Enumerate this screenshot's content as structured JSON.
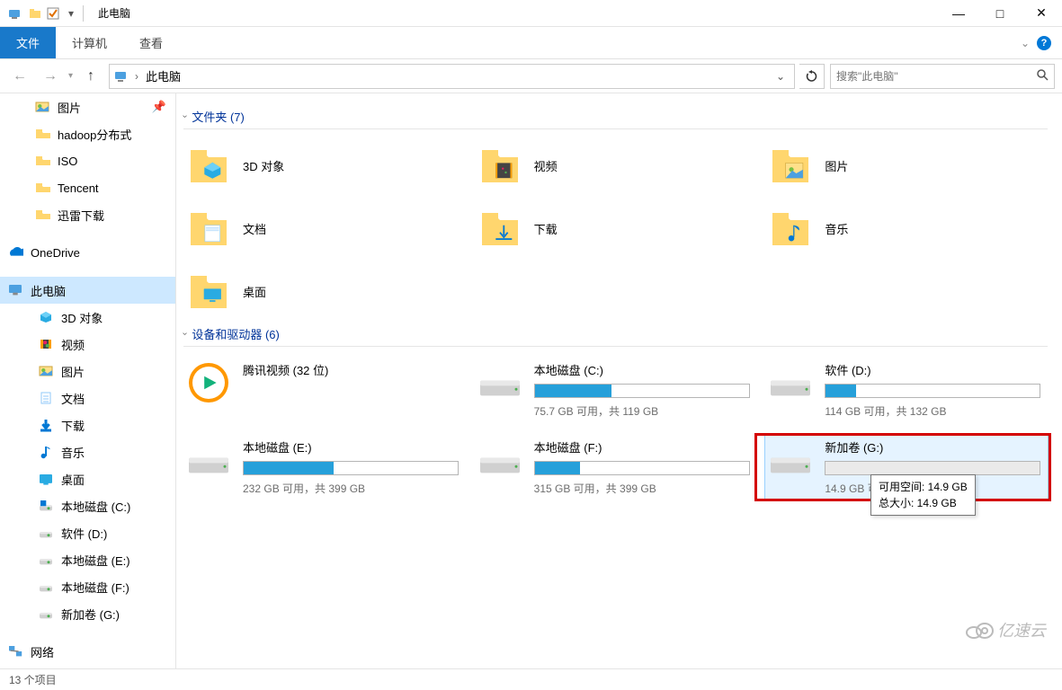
{
  "window": {
    "title": "此电脑",
    "minimize": "—",
    "maximize": "□",
    "close": "✕"
  },
  "ribbon": {
    "file": "文件",
    "computer": "计算机",
    "view": "查看",
    "chevron": "⌄",
    "help": "?"
  },
  "nav": {
    "back": "←",
    "forward": "→",
    "up": "↑",
    "location": "此电脑",
    "sep": "›",
    "refresh": "⟳",
    "search_placeholder": "搜索\"此电脑\""
  },
  "sidebar": [
    {
      "label": "图片",
      "icon": "pictures-icon",
      "indent": 1,
      "pin": true
    },
    {
      "label": "hadoop分布式",
      "icon": "folder-icon",
      "indent": 1
    },
    {
      "label": "ISO",
      "icon": "folder-icon",
      "indent": 1
    },
    {
      "label": "Tencent",
      "icon": "folder-icon",
      "indent": 1
    },
    {
      "label": "迅雷下载",
      "icon": "folder-icon",
      "indent": 1
    },
    {
      "spacer": true
    },
    {
      "label": "OneDrive",
      "icon": "onedrive-icon",
      "indent": 0
    },
    {
      "spacer": true
    },
    {
      "label": "此电脑",
      "icon": "this-pc-icon",
      "indent": 0,
      "selected": true
    },
    {
      "label": "3D 对象",
      "icon": "3d-objects-icon",
      "indent": 2
    },
    {
      "label": "视频",
      "icon": "videos-icon",
      "indent": 2
    },
    {
      "label": "图片",
      "icon": "pictures-icon",
      "indent": 2
    },
    {
      "label": "文档",
      "icon": "documents-icon",
      "indent": 2
    },
    {
      "label": "下载",
      "icon": "downloads-icon",
      "indent": 2
    },
    {
      "label": "音乐",
      "icon": "music-icon",
      "indent": 2
    },
    {
      "label": "桌面",
      "icon": "desktop-icon",
      "indent": 2
    },
    {
      "label": "本地磁盘 (C:)",
      "icon": "drive-c-icon",
      "indent": 2
    },
    {
      "label": "软件 (D:)",
      "icon": "drive-icon",
      "indent": 2
    },
    {
      "label": "本地磁盘 (E:)",
      "icon": "drive-icon",
      "indent": 2
    },
    {
      "label": "本地磁盘 (F:)",
      "icon": "drive-icon",
      "indent": 2
    },
    {
      "label": "新加卷 (G:)",
      "icon": "drive-icon",
      "indent": 2
    },
    {
      "spacer": true
    },
    {
      "label": "网络",
      "icon": "network-icon",
      "indent": 0
    }
  ],
  "groups": {
    "folders": {
      "header": "文件夹 (7)"
    },
    "drives": {
      "header": "设备和驱动器 (6)"
    }
  },
  "folders": [
    {
      "label": "3D 对象",
      "icon": "3d-objects-icon"
    },
    {
      "label": "视频",
      "icon": "videos-icon"
    },
    {
      "label": "图片",
      "icon": "pictures-icon"
    },
    {
      "label": "文档",
      "icon": "documents-icon"
    },
    {
      "label": "下载",
      "icon": "downloads-icon"
    },
    {
      "label": "音乐",
      "icon": "music-icon"
    },
    {
      "label": "桌面",
      "icon": "desktop-icon"
    }
  ],
  "drives": [
    {
      "label": "腾讯视频 (32 位)",
      "icon": "tencent-video-icon",
      "no_bar": true
    },
    {
      "label": "本地磁盘 (C:)",
      "stats": "75.7 GB 可用，共 119 GB",
      "fill": 36
    },
    {
      "label": "软件 (D:)",
      "stats": "114 GB 可用，共 132 GB",
      "fill": 14
    },
    {
      "label": "本地磁盘 (E:)",
      "stats": "232 GB 可用，共 399 GB",
      "fill": 42
    },
    {
      "label": "本地磁盘 (F:)",
      "stats": "315 GB 可用，共 399 GB",
      "fill": 21
    },
    {
      "label": "新加卷 (G:)",
      "stats": "14.9 GB 可用，共 14.9 GB",
      "fill": 0,
      "highlighted": true,
      "redbox": true
    }
  ],
  "tooltip": {
    "line1": "可用空间: 14.9 GB",
    "line2": "总大小: 14.9 GB"
  },
  "statusbar": {
    "items": "13 个项目"
  },
  "watermark": "亿速云"
}
